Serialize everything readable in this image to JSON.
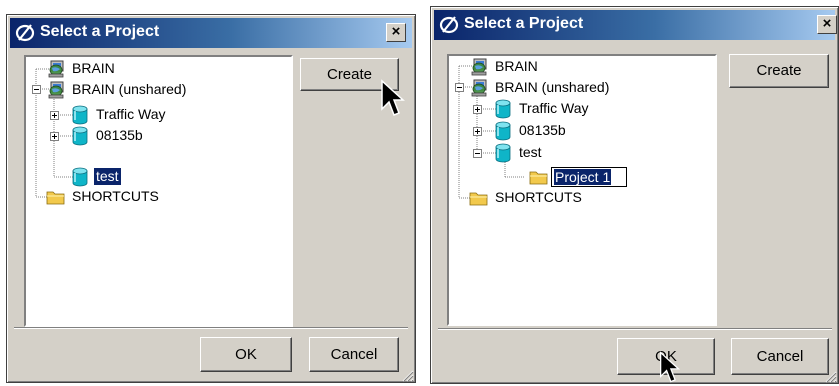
{
  "dialog_left": {
    "title": "Select a Project",
    "close_label": "×",
    "tree": [
      {
        "label": "BRAIN",
        "icon": "network-computer-icon"
      },
      {
        "label": "BRAIN (unshared)",
        "icon": "network-computer-icon"
      },
      {
        "label": "Traffic Way",
        "icon": "database-icon"
      },
      {
        "label": "08135b",
        "icon": "database-icon"
      },
      {
        "label": "test",
        "icon": "database-icon",
        "selected": true
      },
      {
        "label": "SHORTCUTS",
        "icon": "folder-icon"
      }
    ],
    "buttons": {
      "create": "Create",
      "ok": "OK",
      "cancel": "Cancel"
    }
  },
  "dialog_right": {
    "title": "Select a Project",
    "close_label": "×",
    "tree": [
      {
        "label": "BRAIN",
        "icon": "network-computer-icon"
      },
      {
        "label": "BRAIN (unshared)",
        "icon": "network-computer-icon"
      },
      {
        "label": "Traffic Way",
        "icon": "database-icon"
      },
      {
        "label": "08135b",
        "icon": "database-icon"
      },
      {
        "label": "test",
        "icon": "database-icon"
      },
      {
        "label": "Project 1",
        "icon": "folder-icon",
        "editing": true
      },
      {
        "label": "SHORTCUTS",
        "icon": "folder-icon"
      }
    ],
    "buttons": {
      "create": "Create",
      "ok": "OK",
      "cancel": "Cancel"
    }
  },
  "colors": {
    "titlebar_start": "#0a246a",
    "titlebar_end": "#a6caf0",
    "dialog_face": "#d4d0c8",
    "selection": "#0a246a"
  }
}
